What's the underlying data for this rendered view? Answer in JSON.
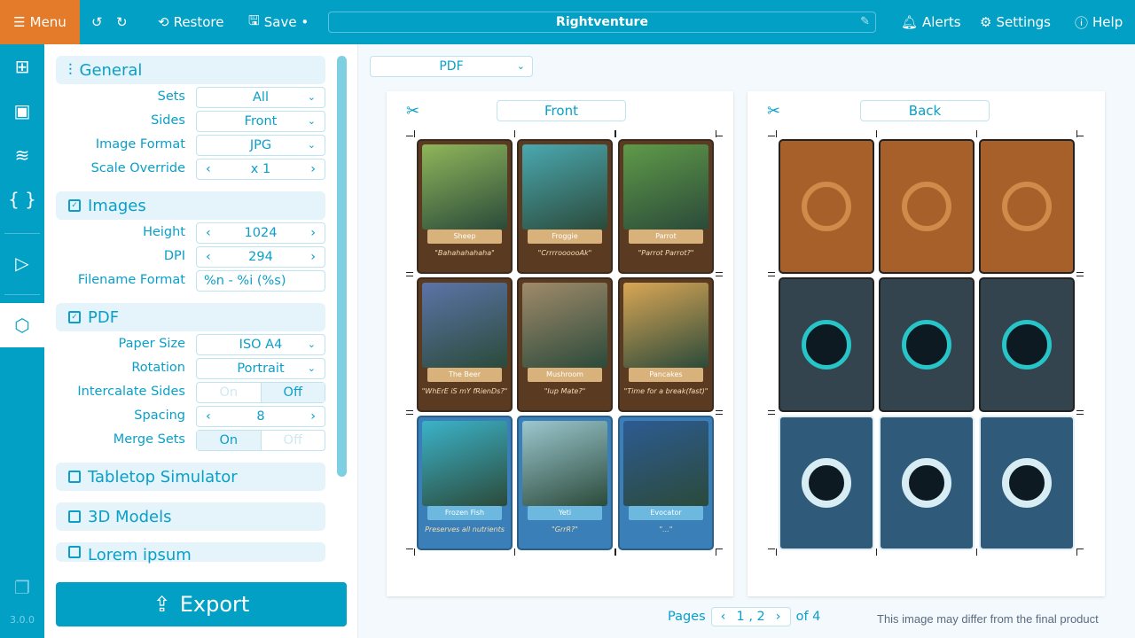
{
  "topbar": {
    "menu": "Menu",
    "restore": "Restore",
    "save": "Save •",
    "title": "Rightventure",
    "alerts": "Alerts",
    "settings": "Settings",
    "help": "Help"
  },
  "rail": {
    "items": [
      "add-component-icon",
      "layout-icon",
      "database-icon",
      "code-braces-icon",
      "play-icon",
      "export-box-icon"
    ],
    "version": "3.0.0"
  },
  "panel": {
    "general": {
      "title": "General",
      "rows": [
        {
          "label": "Sets",
          "value": "All",
          "type": "select"
        },
        {
          "label": "Sides",
          "value": "Front",
          "type": "select"
        },
        {
          "label": "Image Format",
          "value": "JPG",
          "type": "select"
        },
        {
          "label": "Scale Override",
          "value": "x 1",
          "type": "stepper"
        }
      ]
    },
    "images": {
      "title": "Images",
      "checked": true,
      "rows": [
        {
          "label": "Height",
          "value": "1024",
          "type": "stepper"
        },
        {
          "label": "DPI",
          "value": "294",
          "type": "stepper"
        },
        {
          "label": "Filename Format",
          "value": "%n - %i (%s)",
          "type": "text"
        }
      ]
    },
    "pdf": {
      "title": "PDF",
      "checked": true,
      "rows": [
        {
          "label": "Paper Size",
          "value": "ISO A4",
          "type": "select"
        },
        {
          "label": "Rotation",
          "value": "Portrait",
          "type": "select"
        },
        {
          "label": "Intercalate Sides",
          "on": "On",
          "off": "Off",
          "selected": "Off",
          "type": "toggle"
        },
        {
          "label": "Spacing",
          "value": "8",
          "type": "stepper"
        },
        {
          "label": "Merge Sets",
          "on": "On",
          "off": "Off",
          "selected": "On",
          "type": "toggle"
        }
      ]
    },
    "tts": {
      "title": "Tabletop Simulator",
      "checked": false
    },
    "models": {
      "title": "3D Models",
      "checked": false
    },
    "lorem": {
      "title": "Lorem ipsum",
      "checked": false
    },
    "export": "Export"
  },
  "preview": {
    "format": "PDF",
    "front_label": "Front",
    "back_label": "Back",
    "front_cards": [
      {
        "name": "Sheep",
        "quote": "\"Bahahahahaha\"",
        "theme": "wood",
        "art": "#8fb65a"
      },
      {
        "name": "Froggie",
        "quote": "\"CrrrroooooAk\"",
        "theme": "wood",
        "art": "#4aa8b0"
      },
      {
        "name": "Parrot",
        "quote": "\"Parrot Parrot?\"",
        "theme": "wood",
        "art": "#5f9a48"
      },
      {
        "name": "The Beer",
        "quote": "\"WhErE iS mY fRienDs?\"",
        "theme": "wood",
        "art": "#5b74a8"
      },
      {
        "name": "Mushroom",
        "quote": "\"Iup Mate?\"",
        "theme": "wood",
        "art": "#a08a6a"
      },
      {
        "name": "Pancakes",
        "quote": "\"Time for a break(fast)\"",
        "theme": "wood",
        "art": "#d9a655"
      },
      {
        "name": "Frozen Fish",
        "quote": "Preserves all nutrients",
        "theme": "ice",
        "art": "#3bb3c9"
      },
      {
        "name": "Yeti",
        "quote": "\"GrrR?\"",
        "theme": "ice",
        "art": "#9cc7cf"
      },
      {
        "name": "Evocator",
        "quote": "\"...\"",
        "theme": "ice",
        "art": "#2d5b92"
      }
    ],
    "back_rows": [
      "wood",
      "stone",
      "ice"
    ],
    "pages": {
      "label": "Pages",
      "current": "1 , 2",
      "total": "of 4"
    },
    "note": "This image may differ from the final product"
  },
  "colors": {
    "accent": "#03a0c6",
    "menu": "#e47b2a"
  }
}
